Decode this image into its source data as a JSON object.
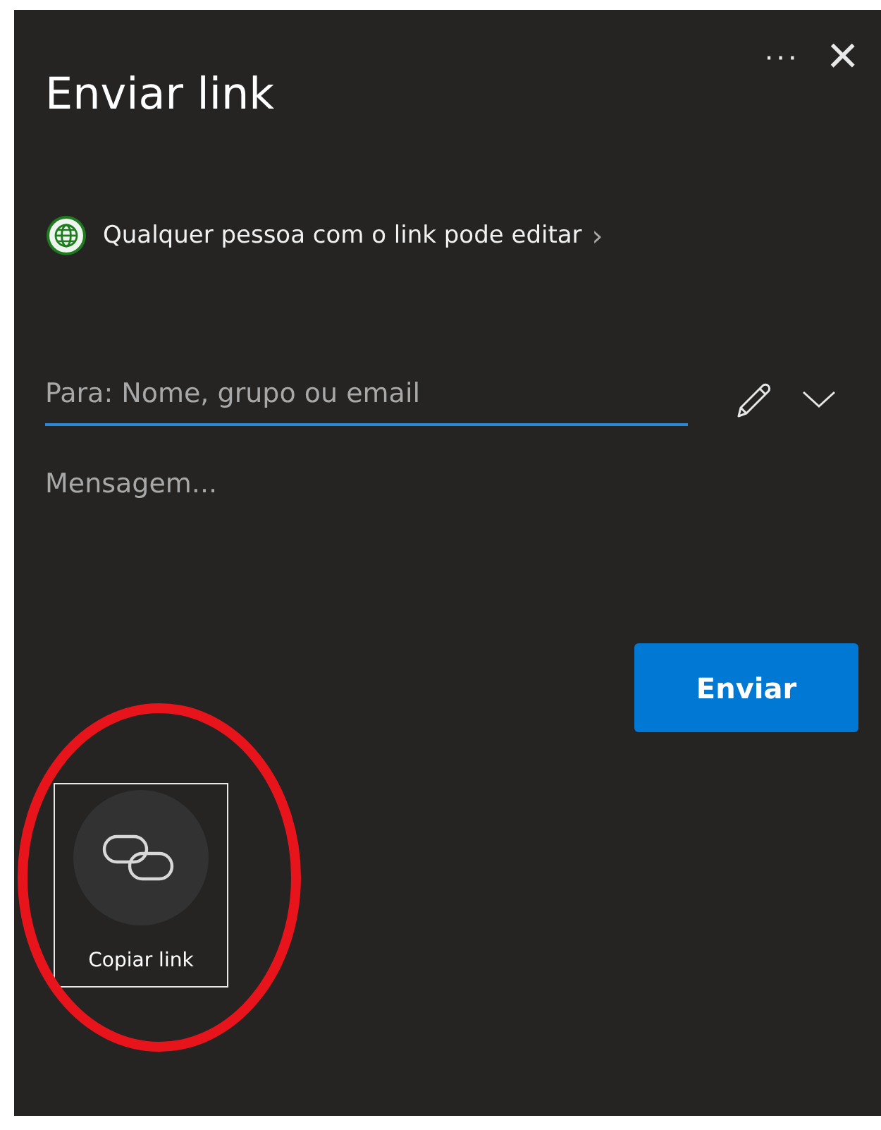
{
  "panel": {
    "title": "Enviar link",
    "more_icon": "···",
    "close_icon": "×"
  },
  "permission": {
    "text": "Qualquer pessoa com o link pode editar",
    "chevron": "›"
  },
  "to_field": {
    "placeholder": "Para: Nome, grupo ou email",
    "focused": true
  },
  "message_field": {
    "placeholder": "Mensagem..."
  },
  "send_button": {
    "label": "Enviar"
  },
  "copy_link": {
    "label": "Copiar link",
    "focused": true
  },
  "annotation": {
    "kind": "ellipse",
    "color": "#e8141c"
  }
}
